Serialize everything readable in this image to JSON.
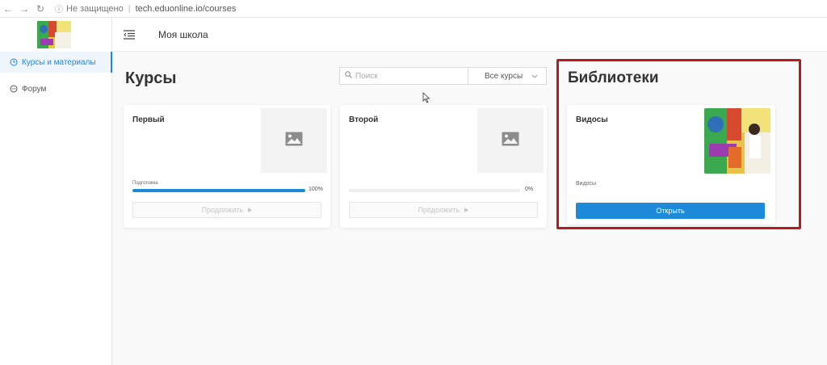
{
  "browser": {
    "security": "Не защищено",
    "url": "tech.eduonline.io/courses"
  },
  "sidebar": {
    "items": [
      {
        "label": "Курсы и материалы",
        "icon": "clock-icon",
        "active": true
      },
      {
        "label": "Форум",
        "icon": "chat-icon",
        "active": false
      }
    ]
  },
  "header": {
    "school_name": "Моя школа"
  },
  "courses": {
    "title": "Курсы",
    "search_placeholder": "Поиск",
    "filter_selected": "Все курсы",
    "cards": [
      {
        "title": "Первый",
        "progress_label": "Подготовка",
        "progress": 100,
        "progress_text": "100%",
        "button_label": "Продолжить"
      },
      {
        "title": "Второй",
        "progress_label": "",
        "progress": 0,
        "progress_text": "0%",
        "button_label": "Продолжить"
      }
    ]
  },
  "libraries": {
    "title": "Библиотеки",
    "cards": [
      {
        "title": "Видосы",
        "subtitle": "Видосы",
        "button_label": "Открыть"
      }
    ]
  },
  "colors": {
    "accent": "#1c8ad9",
    "highlight": "#b51b1b"
  }
}
